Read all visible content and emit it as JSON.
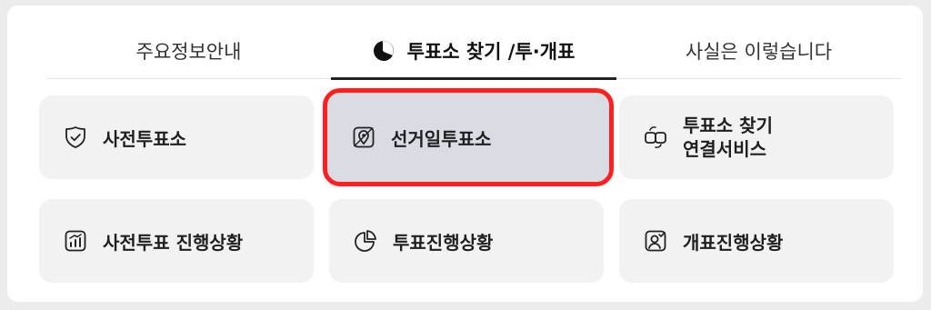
{
  "tabs": [
    {
      "label": "주요정보안내"
    },
    {
      "label": "투표소 찾기 /투·개표"
    },
    {
      "label": "사실은 이렇습니다"
    }
  ],
  "buttons": [
    {
      "label": "사전투표소",
      "icon": "check-shield-icon"
    },
    {
      "label": "선거일투표소",
      "icon": "map-pin-icon"
    },
    {
      "line1": "투표소 찾기",
      "line2": "연결서비스",
      "icon": "link-arrows-icon"
    },
    {
      "label": "사전투표 진행상황",
      "icon": "growth-chart-icon"
    },
    {
      "label": "투표진행상황",
      "icon": "pie-chart-icon"
    },
    {
      "label": "개표진행상황",
      "icon": "user-check-icon"
    }
  ],
  "colors": {
    "selected_outline": "#ff1f1f",
    "selected_bg": "#d9dde3",
    "button_bg": "#f2f2f2"
  }
}
